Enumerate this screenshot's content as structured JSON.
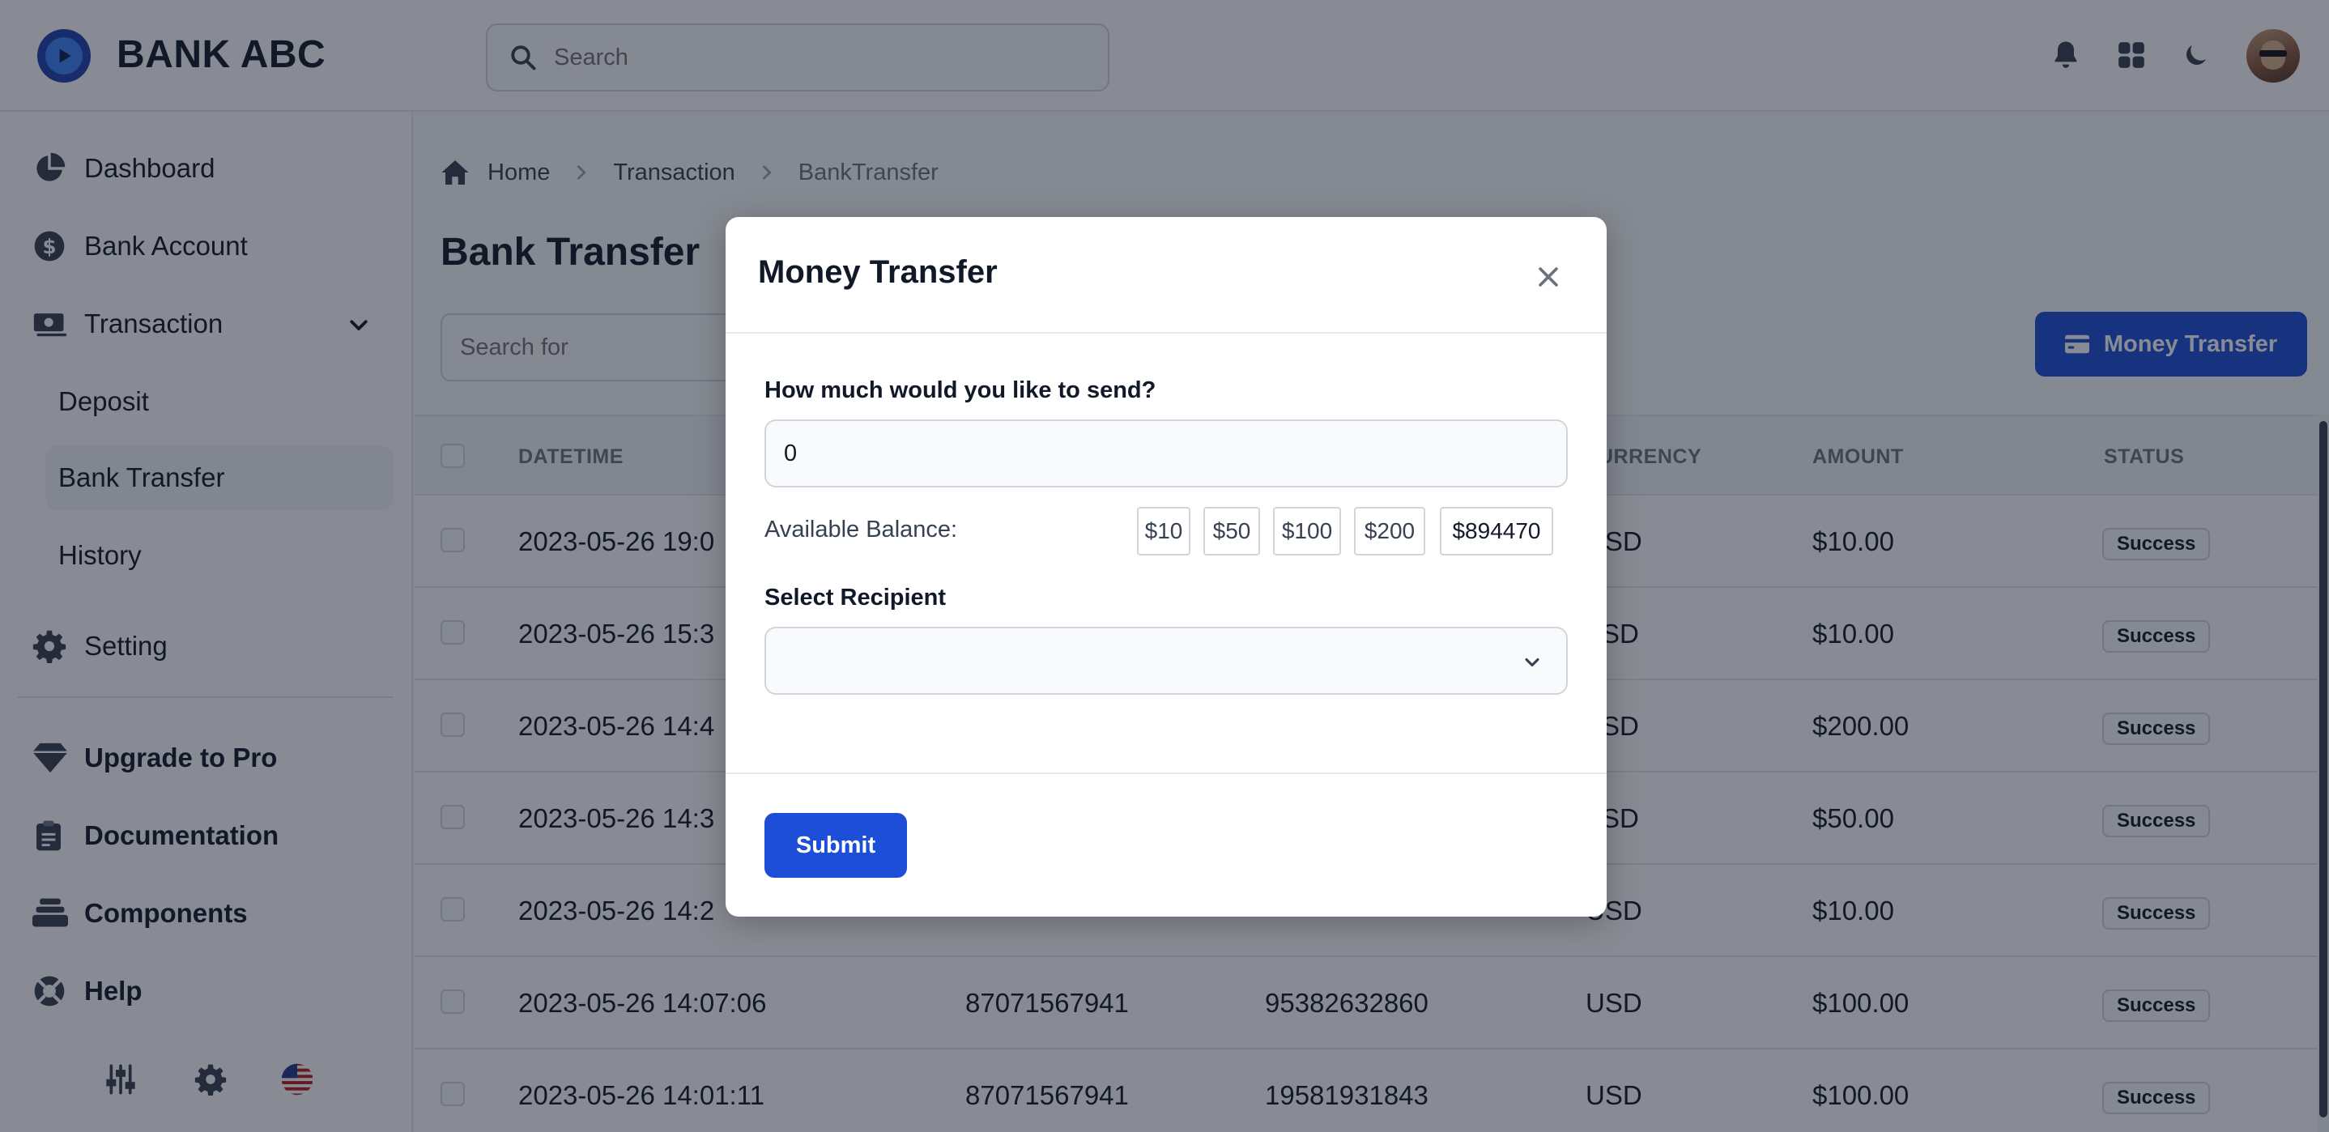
{
  "app": {
    "brand": "BANK ABC"
  },
  "topbar": {
    "search_placeholder": "Search"
  },
  "sidebar": {
    "items": [
      {
        "label": "Dashboard"
      },
      {
        "label": "Bank Account"
      },
      {
        "label": "Transaction"
      },
      {
        "label": "Deposit"
      },
      {
        "label": "Bank Transfer"
      },
      {
        "label": "History"
      },
      {
        "label": "Setting"
      }
    ],
    "secondary": [
      {
        "label": "Upgrade to Pro"
      },
      {
        "label": "Documentation"
      },
      {
        "label": "Components"
      },
      {
        "label": "Help"
      }
    ]
  },
  "breadcrumb": {
    "home": "Home",
    "transaction": "Transaction",
    "current": "BankTransfer"
  },
  "page": {
    "title": "Bank Transfer",
    "search_placeholder": "Search for",
    "transfer_button": "Money Transfer"
  },
  "table": {
    "columns": {
      "datetime": "DATETIME",
      "currency": "URRENCY",
      "amount": "AMOUNT",
      "status": "STATUS"
    },
    "rows": [
      {
        "datetime": "2023-05-26 19:0",
        "from": "",
        "to": "",
        "currency": "USD",
        "amount": "$10.00",
        "status": "Success"
      },
      {
        "datetime": "2023-05-26 15:3",
        "from": "",
        "to": "",
        "currency": "SD",
        "amount": "$10.00",
        "status": "Success"
      },
      {
        "datetime": "2023-05-26 14:4",
        "from": "",
        "to": "",
        "currency": "SD",
        "amount": "$200.00",
        "status": "Success"
      },
      {
        "datetime": "2023-05-26 14:3",
        "from": "",
        "to": "",
        "currency": "SD",
        "amount": "$50.00",
        "status": "Success"
      },
      {
        "datetime": "2023-05-26 14:2",
        "from": "",
        "to": "",
        "currency": "USD",
        "amount": "$10.00",
        "status": "Success"
      },
      {
        "datetime": "2023-05-26 14:07:06",
        "from": "87071567941",
        "to": "95382632860",
        "currency": "USD",
        "amount": "$100.00",
        "status": "Success"
      },
      {
        "datetime": "2023-05-26 14:01:11",
        "from": "87071567941",
        "to": "19581931843",
        "currency": "USD",
        "amount": "$100.00",
        "status": "Success"
      }
    ]
  },
  "modal": {
    "title": "Money Transfer",
    "amount_label": "How much would you like to send?",
    "amount_value": "0",
    "balance_label": "Available Balance:",
    "quick_amounts": [
      "$10",
      "$50",
      "$100",
      "$200",
      "$894470"
    ],
    "recipient_label": "Select Recipient",
    "recipient_value": "",
    "submit_label": "Submit"
  },
  "colors": {
    "primary": "#1d4ed8",
    "logo": "#1e40af",
    "overlay": "#111827"
  }
}
